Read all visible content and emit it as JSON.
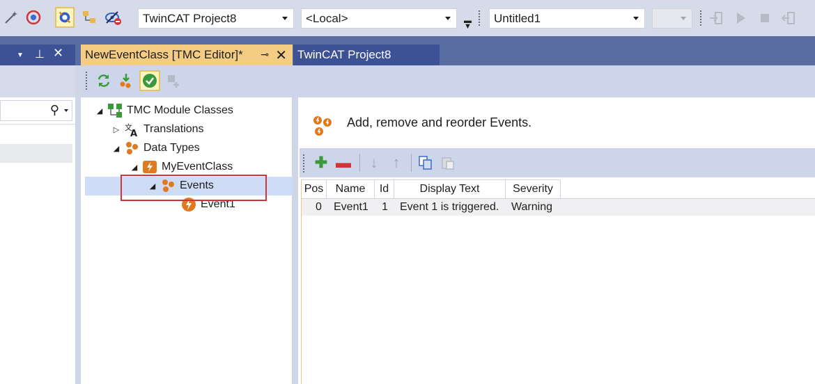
{
  "toolbar": {
    "project_combo": "TwinCAT Project8",
    "target_combo": "<Local>",
    "file_combo": "Untitled1",
    "disabled_combo": ""
  },
  "tabs": {
    "active_label": "NewEventClass [TMC Editor]*",
    "inactive_label": "TwinCAT Project8"
  },
  "tree": {
    "root": "TMC Module Classes",
    "translations": "Translations",
    "data_types": "Data Types",
    "event_class": "MyEventClass",
    "events": "Events",
    "event1": "Event1"
  },
  "content": {
    "heading": "Add, remove and reorder Events."
  },
  "grid": {
    "columns": [
      "Pos",
      "Name",
      "Id",
      "Display Text",
      "Severity"
    ],
    "rows": [
      {
        "pos": "0",
        "name": "Event1",
        "id": "1",
        "display_text": "Event 1 is triggered.",
        "severity": "Warning"
      }
    ]
  },
  "colors": {
    "accent_tab": "#f5cc84",
    "tab_band": "#5a6da0",
    "selection": "#cfdcf5",
    "highlight_box": "#d0343a"
  }
}
